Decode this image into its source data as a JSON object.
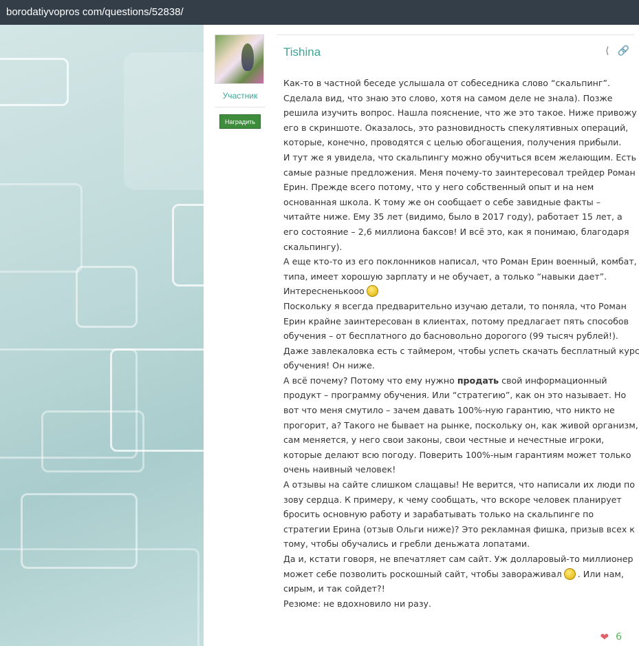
{
  "browser": {
    "url": "borodatiyvopros com/questions/52838/"
  },
  "user": {
    "role": "Участник",
    "award_label": "Наградить",
    "name": "Tishina"
  },
  "post": {
    "lines": [
      [
        {
          "text": "Как-то в частной беседе услышала от собеседника слово “скальпинг”."
        }
      ],
      [
        {
          "text": "Сделала вид, что знаю это слово, хотя на самом деле не знала). Позже"
        }
      ],
      [
        {
          "text": "решила изучить вопрос. Нашла пояснение, что же это такое. Ниже привожу"
        }
      ],
      [
        {
          "text": "его в скриншоте. Оказалось, это разновидность спекулятивных операций,"
        }
      ],
      [
        {
          "text": "которые, конечно, проводятся с целью обогащения, получения прибыли."
        }
      ],
      [
        {
          "text": "И тут же я увидела, что скальпингу можно обучиться всем желающим. Есть"
        }
      ],
      [
        {
          "text": "самые разные предложения. Меня почему-то заинтересовал трейдер Роман"
        }
      ],
      [
        {
          "text": "Ерин. Прежде всего потому, что у него собственный опыт и на нем"
        }
      ],
      [
        {
          "text": "основанная школа. К тому же он сообщает о себе завидные факты –"
        }
      ],
      [
        {
          "text": "читайте ниже. Ему 35 лет (видимо, было в 2017 году), работает 15 лет, а"
        }
      ],
      [
        {
          "text": "его состояние – 2,6 миллиона баксов! И всё это, как я понимаю, благодаря"
        }
      ],
      [
        {
          "text": "скальпингу)."
        }
      ],
      [
        {
          "text": "А еще кто-то из его поклонников написал, что Роман Ерин военный, комбат,"
        }
      ],
      [
        {
          "text": "типа, имеет хорошую зарплату и не обучает, а только “навыки дает”."
        }
      ],
      [
        {
          "text": "Интересненькооо"
        },
        {
          "emoji": "smiley-icon"
        }
      ],
      [
        {
          "text": "Поскольку я всегда предварительно изучаю детали, то поняла, что Роман"
        }
      ],
      [
        {
          "text": "Ерин крайне заинтересован в клиентах, потому предлагает пять способов"
        }
      ],
      [
        {
          "text": "обучения – от бесплатного до басновольно дорогого (99 тысяч рублей!)."
        }
      ],
      [
        {
          "text": "Даже завлекаловка есть с таймером, чтобы успеть скачать бесплатный курс"
        }
      ],
      [
        {
          "text": "обучения! Он ниже."
        }
      ],
      [
        {
          "text": "А всё почему? Потому что ему нужно "
        },
        {
          "text": "продать",
          "bold": true
        },
        {
          "text": " свой информационный"
        }
      ],
      [
        {
          "text": "продукт – программу обучения. Или “стратегию”, как он это называет. Но"
        }
      ],
      [
        {
          "text": "вот что меня смутило – зачем давать 100%-ную гарантию, что никто не"
        }
      ],
      [
        {
          "text": "прогорит, а? Такого не бывает на рынке, поскольку он, как живой организм,"
        }
      ],
      [
        {
          "text": "сам меняется, у него свои законы, свои честные и нечестные игроки,"
        }
      ],
      [
        {
          "text": "которые делают всю погоду. Поверить 100%-ным гарантиям может только"
        }
      ],
      [
        {
          "text": "очень наивный человек!"
        }
      ],
      [
        {
          "text": "А отзывы на сайте слишком слащавы! Не верится, что написали их люди по"
        }
      ],
      [
        {
          "text": "зову сердца. К примеру, к чему сообщать, что вскоре человек планирует"
        }
      ],
      [
        {
          "text": "бросить основную работу и зарабатывать только на скальпинге по"
        }
      ],
      [
        {
          "text": "стратегии Ерина (отзыв Ольги ниже)? Это рекламная фишка, призыв всех к"
        }
      ],
      [
        {
          "text": "тому, чтобы обучались и гребли деньжата лопатами."
        }
      ],
      [
        {
          "text": "Да и, кстати говоря, не впечатляет сам сайт. Уж долларовый-то миллионер"
        }
      ],
      [
        {
          "text": "может себе позволить роскошный сайт, чтобы завораживал"
        },
        {
          "emoji": "smiley-icon"
        },
        {
          "text": ". Или нам,"
        }
      ],
      [
        {
          "text": "сирым, и так сойдет?!"
        }
      ],
      [
        {
          "text": "Резюме: не вдохновило ни разу."
        }
      ]
    ],
    "likes": "6"
  },
  "colors": {
    "accent": "#3aa596",
    "award": "#3d8d3d",
    "topbar": "#343e48",
    "heart": "#e0606a",
    "count": "#5cb85c"
  }
}
